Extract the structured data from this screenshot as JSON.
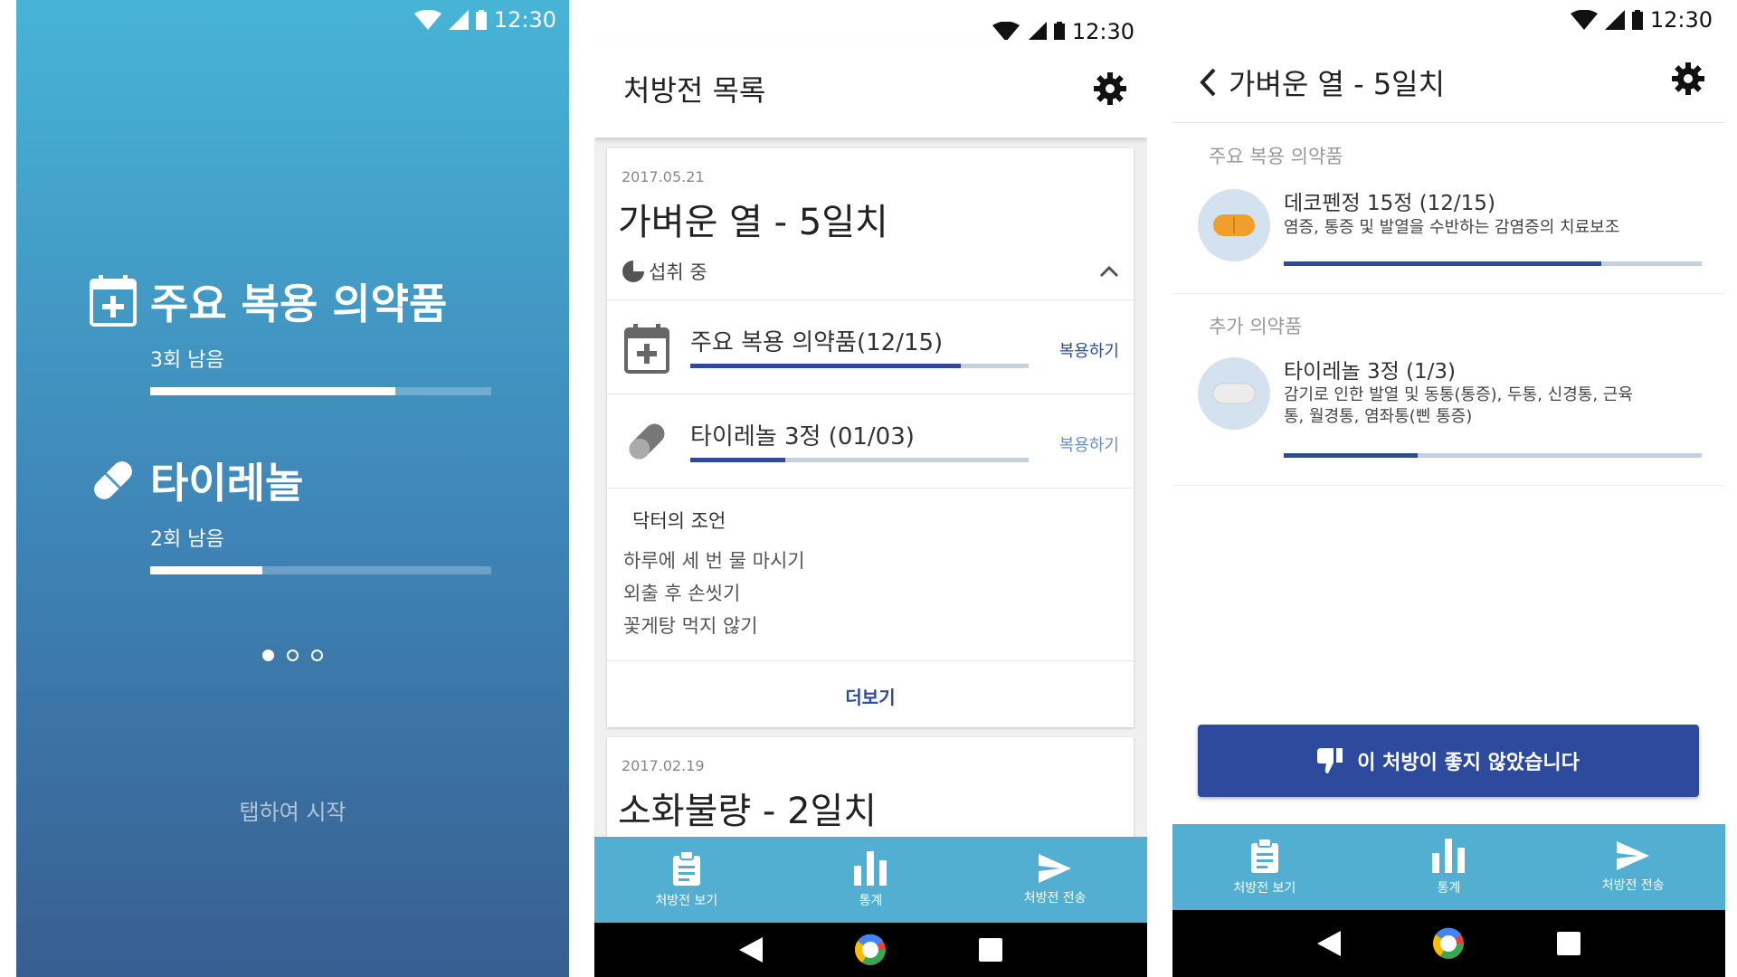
{
  "status_bar": {
    "time": "12:30"
  },
  "onboarding": {
    "items": [
      {
        "icon": "calendar-plus-icon",
        "title": "주요 복용 의약품",
        "remaining": "3회 남음",
        "progress": 0.72
      },
      {
        "icon": "pill-icon",
        "title": "타이레놀",
        "remaining": "2회 남음",
        "progress": 0.33
      }
    ],
    "page_index": 0,
    "page_count": 3,
    "tap_hint": "탭하여 시작"
  },
  "list_screen": {
    "title": "처방전 목록",
    "prescriptions": [
      {
        "date": "2017.05.21",
        "name": "가벼운 열 - 5일치",
        "status": "섭취 중",
        "meds": [
          {
            "label": "주요 복용 의약품(12/15)",
            "action": "복용하기",
            "progress": 0.8
          },
          {
            "label": "타이레놀 3정 (01/03)",
            "action": "복용하기",
            "progress": 0.33
          }
        ],
        "advice_title": "닥터의 조언",
        "advice": [
          "하루에 세 번 물 마시기",
          "외출 후 손씻기",
          "꽃게탕 먹지 않기"
        ],
        "more": "더보기"
      },
      {
        "date": "2017.02.19",
        "name": "소화불량 - 2일치"
      }
    ]
  },
  "detail_screen": {
    "title": "가벼운 열 - 5일치",
    "sections": [
      {
        "header": "주요 복용 의약품",
        "name": "데코펜정 15정 (12/15)",
        "desc": "염증, 통증 및 발열을 수반하는 감염증의 치료보조",
        "progress": 0.76,
        "pill_color": "#f0a02a"
      },
      {
        "header": "추가 의약품",
        "name": "타이레놀 3정 (1/3)",
        "desc": "감기로 인한 발열 및 동통(통증), 두통, 신경통, 근육통, 월경통, 염좌통(삔 통증)",
        "progress": 0.32,
        "pill_color": "#ececec"
      }
    ],
    "dislike_button": "이 처방이 좋지 않았습니다"
  },
  "bottom_nav": [
    {
      "icon": "clipboard-icon",
      "label": "처방전 보기"
    },
    {
      "icon": "bar-chart-icon",
      "label": "통계"
    },
    {
      "icon": "send-icon",
      "label": "처방전 전송"
    }
  ],
  "colors": {
    "primary": "#2d4a9d",
    "nav": "#52afd1",
    "gradient_top": "#47b4d6",
    "gradient_bottom": "#385e90"
  }
}
